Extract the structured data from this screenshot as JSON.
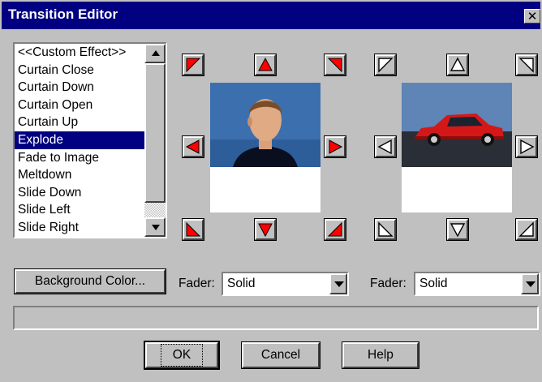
{
  "window": {
    "title": "Transition Editor",
    "close_glyph": "✕"
  },
  "effects_list": {
    "items": [
      "<<Custom Effect>>",
      "Curtain Close",
      "Curtain Down",
      "Curtain Open",
      "Curtain Up",
      "Explode",
      "Fade to Image",
      "Meltdown",
      "Slide Down",
      "Slide Left",
      "Slide Right"
    ],
    "selected": "Explode"
  },
  "direction_arrows": {
    "source": {
      "color": "#ff0000",
      "style": "filled",
      "directions": [
        "up-left",
        "up",
        "up-right",
        "left",
        "right",
        "down-left",
        "down",
        "down-right"
      ]
    },
    "target": {
      "color": "#ffffff",
      "style": "outline",
      "directions": [
        "up-left",
        "up",
        "up-right",
        "left",
        "right",
        "down-left",
        "down",
        "down-right"
      ]
    }
  },
  "previews": {
    "source": {
      "icon": "man-portrait-image"
    },
    "target": {
      "icon": "red-car-image"
    }
  },
  "controls": {
    "background_color_label": "Background Color...",
    "fader1": {
      "label": "Fader:",
      "value": "Solid"
    },
    "fader2": {
      "label": "Fader:",
      "value": "Solid"
    }
  },
  "buttons": {
    "ok": "OK",
    "cancel": "Cancel",
    "help": "Help"
  },
  "colors": {
    "titlebar": "#000080",
    "face": "#c0c0c0",
    "selection": "#000080",
    "arrow_red": "#ff0000"
  }
}
